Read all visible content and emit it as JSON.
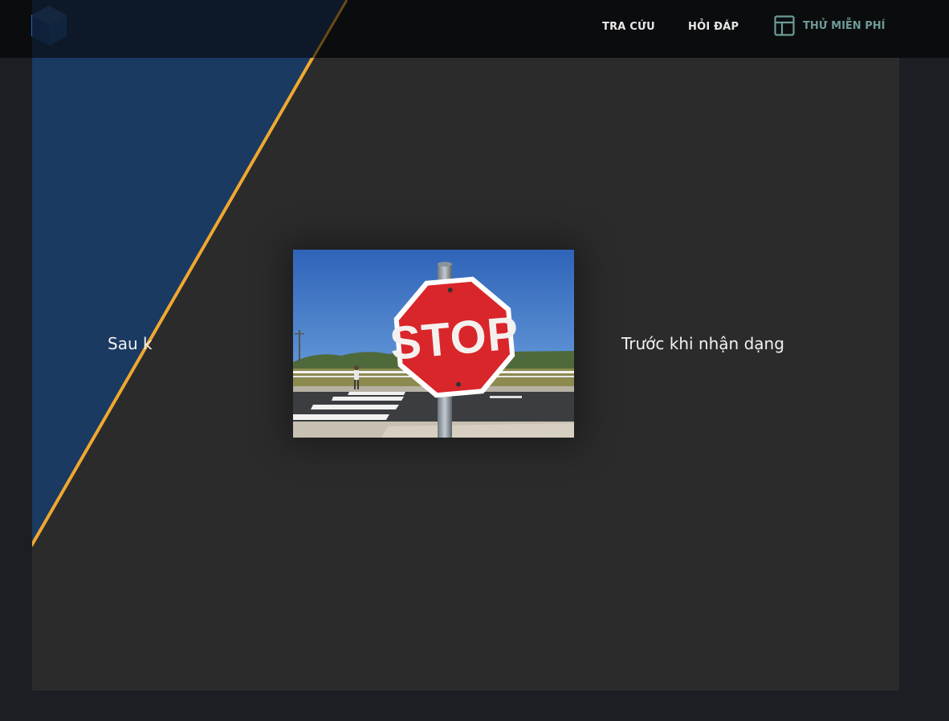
{
  "header": {
    "nav": {
      "lookup_label": "TRA CỨU",
      "faq_label": "HỎI ĐÁP",
      "trial_label": "THỬ MIỄN PHÍ"
    }
  },
  "comparison": {
    "after_caption": "Sau k",
    "before_caption": "Trước khi nhận dạng",
    "image": {
      "sign_text": "STOP"
    }
  },
  "colors": {
    "header_bg": "#0b0c0e",
    "page_bg": "#1c1e24",
    "panel_bg": "#2b2b2b",
    "after_bg": "#1a3a62",
    "divider": "#f0a830",
    "trial_accent": "#6e9b97",
    "stop_red": "#d9262a"
  },
  "icons": {
    "logo": "cube-logo-icon",
    "trial": "layout-panel-icon"
  }
}
